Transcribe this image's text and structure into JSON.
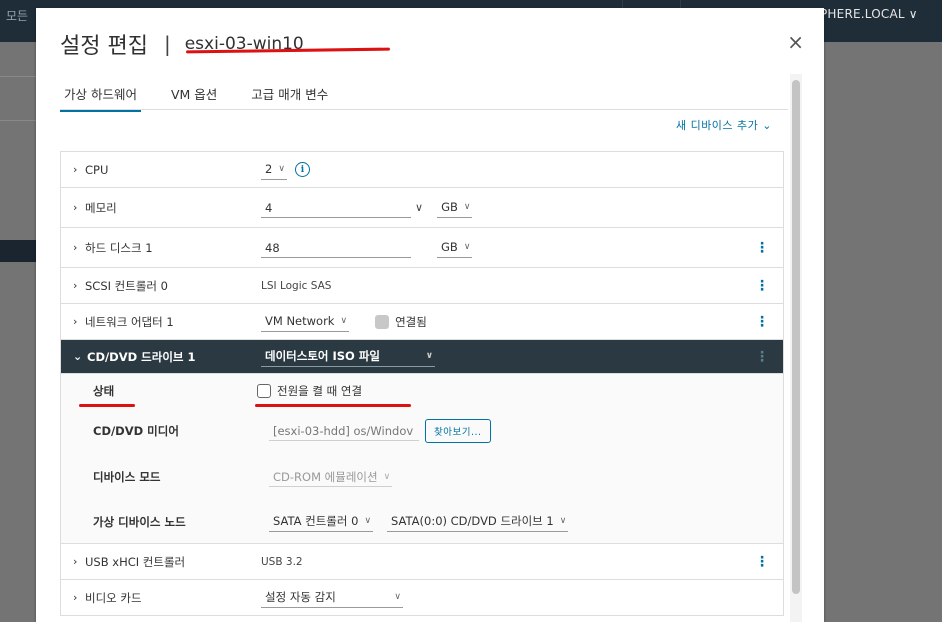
{
  "background": {
    "left_text": "모든",
    "right_text": "PHERE.LOCAL ∨"
  },
  "dialog": {
    "title": "설정 편집",
    "separator": "|",
    "vm_name": "esxi-03-win10",
    "close_symbol": "×"
  },
  "tabs": [
    {
      "label": "가상 하드웨어",
      "active": true
    },
    {
      "label": "VM 옵션",
      "active": false
    },
    {
      "label": "고급 매개 변수",
      "active": false
    }
  ],
  "add_device_label": "새 디바이스 추가 ⌄",
  "hardware": {
    "cpu": {
      "label": "CPU",
      "value": "2"
    },
    "memory": {
      "label": "메모리",
      "value": "4",
      "unit": "GB"
    },
    "hard_disk": {
      "label": "하드 디스크 1",
      "value": "48",
      "unit": "GB"
    },
    "scsi": {
      "label": "SCSI 컨트롤러 0",
      "value": "LSI Logic SAS"
    },
    "network": {
      "label": "네트워크 어댑터 1",
      "value": "VM Network",
      "connected_label": "연결됨"
    },
    "cdrom": {
      "label": "CD/DVD 드라이브 1",
      "value": "데이터스토어 ISO 파일",
      "status_label": "상태",
      "status_checkbox_label": "전원을 켤 때 연결",
      "media_label": "CD/DVD 미디어",
      "media_value": "[esxi-03-hdd] os/Windov",
      "browse_label": "찾아보기...",
      "mode_label": "디바이스 모드",
      "mode_value": "CD-ROM 에뮬레이션",
      "node_label": "가상 디바이스 노드",
      "node_controller": "SATA 컨트롤러 0",
      "node_value": "SATA(0:0) CD/DVD 드라이브 1"
    },
    "usb": {
      "label": "USB xHCI 컨트롤러",
      "value": "USB 3.2"
    },
    "video": {
      "label": "비디오 카드",
      "value": "설정 자동 감지"
    }
  },
  "icons": {
    "expand": "›",
    "collapse": "⌄",
    "info": "i",
    "kebab": "⋮"
  },
  "colors": {
    "accent": "#0072a3",
    "header_dark": "#2b3a42",
    "annotation_red": "#dd1111"
  }
}
